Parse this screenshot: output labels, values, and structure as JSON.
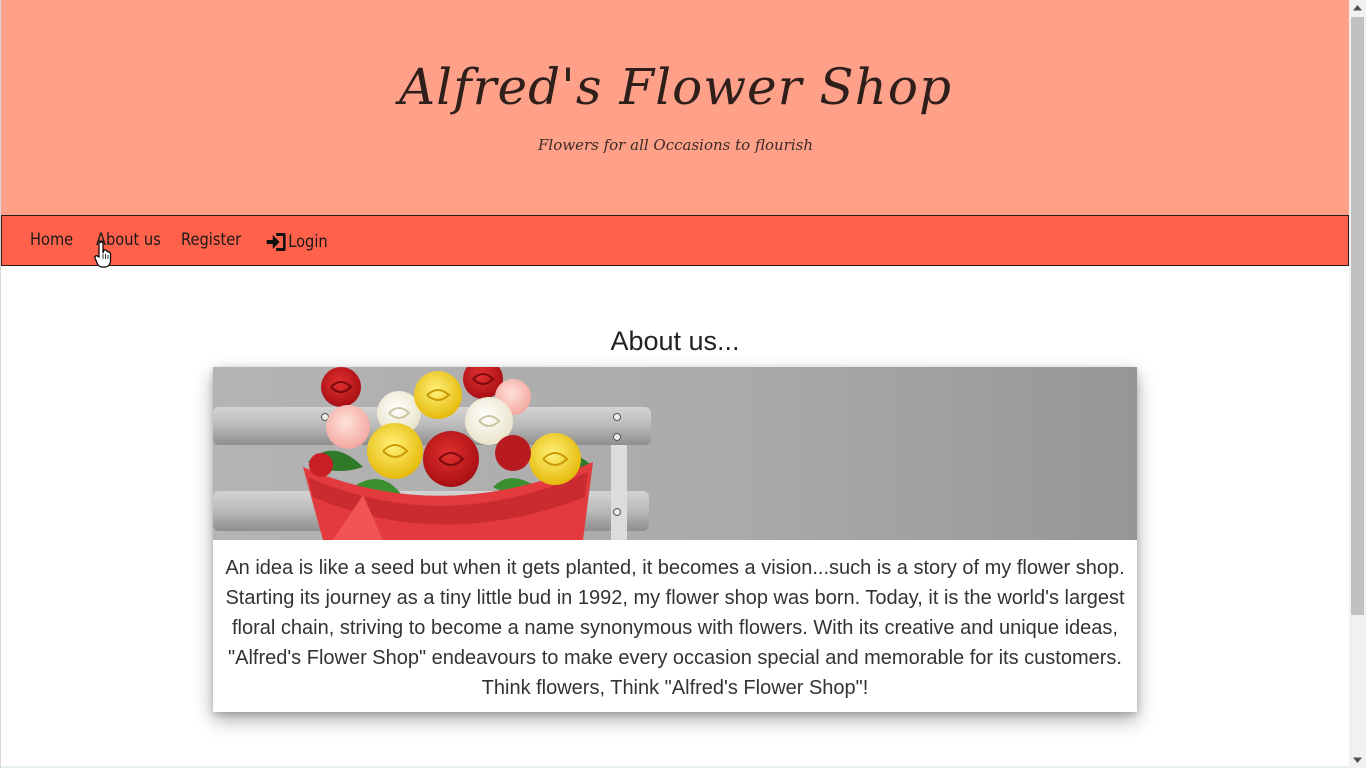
{
  "header": {
    "title": "Alfred's Flower Shop",
    "subtitle": "Flowers for all Occasions to flourish",
    "background": "#ffa089"
  },
  "nav": {
    "background": "#ff614b",
    "items": [
      {
        "label": "Home"
      },
      {
        "label": "About us"
      },
      {
        "label": "Register"
      },
      {
        "label": "Login",
        "icon": "sign-in-icon"
      }
    ]
  },
  "main": {
    "heading": "About us...",
    "card": {
      "image": "flower-bouquet-image",
      "text": "An idea is like a seed but when it gets planted, it becomes a vision...such is a story of my flower shop. Starting its journey as a tiny little bud in 1992, my flower shop was born. Today, it is the world's largest floral chain, striving to become a name synonymous with flowers. With its creative and unique ideas, \"Alfred's Flower Shop\" endeavours to make every occasion special and memorable for its customers. Think flowers, Think \"Alfred's Flower Shop\"!"
    }
  }
}
